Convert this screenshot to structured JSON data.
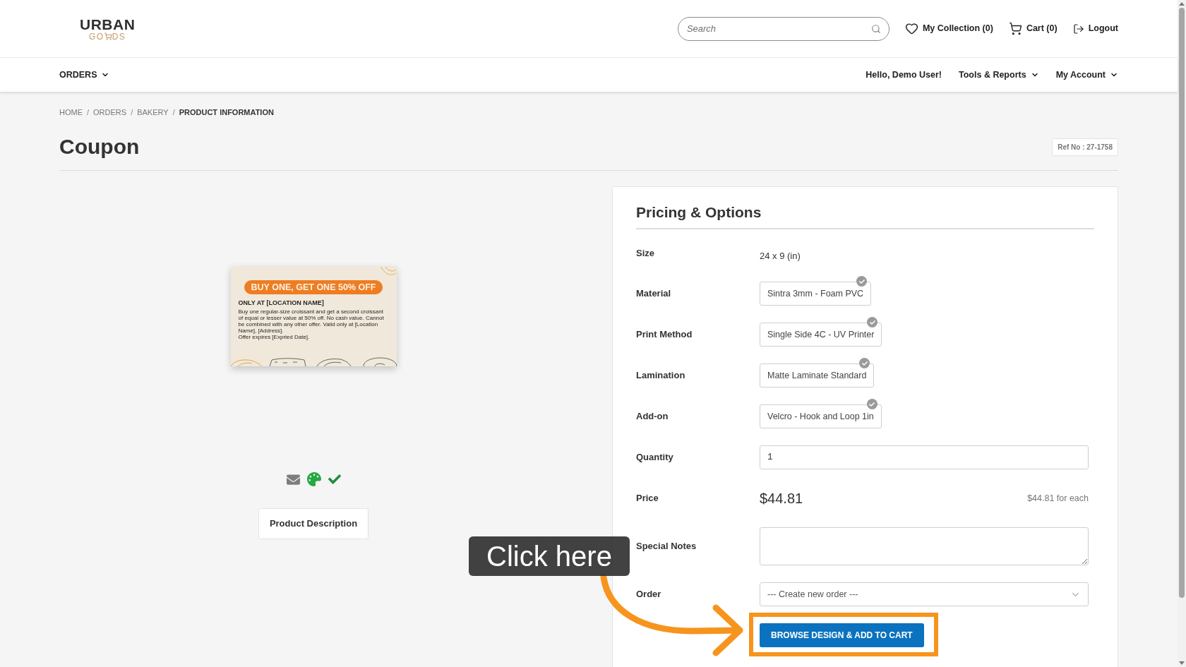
{
  "header": {
    "logo": {
      "top": "URBAN",
      "bottom_left": "GO",
      "bottom_right": "DS"
    },
    "search": {
      "placeholder": "Search"
    },
    "links": [
      {
        "kind": "collection",
        "label": "My Collection (0)"
      },
      {
        "kind": "cart",
        "label": "Cart (0)"
      },
      {
        "kind": "logout",
        "label": "Logout"
      }
    ]
  },
  "nav": {
    "left": [
      {
        "label": "ORDERS",
        "has_menu": true
      }
    ],
    "right": [
      {
        "label": "Hello, Demo User!",
        "has_menu": false
      },
      {
        "label": "Tools & Reports",
        "has_menu": true
      },
      {
        "label": "My Account",
        "has_menu": true
      }
    ]
  },
  "breadcrumb": {
    "separator": "/",
    "items": [
      {
        "label": "HOME",
        "current": false
      },
      {
        "label": "ORDERS",
        "current": false
      },
      {
        "label": "BAKERY",
        "current": false
      },
      {
        "label": "PRODUCT INFORMATION",
        "current": true
      }
    ]
  },
  "page": {
    "title": "Coupon",
    "ref_no": "Ref No : 27-1758"
  },
  "product": {
    "image": {
      "headline": "BUY ONE, GET ONE 50% OFF",
      "subheadline": "ONLY AT [LOCATION NAME]",
      "body": [
        "Buy one regular-size croissant and get a second croissant of equal or lesser value at 50% off. No cash value. Cannot be combined with any other offer. Valid only at [Location Name], [Address].",
        "Offer expires [Expried Date]."
      ]
    },
    "description_button": "Product Description"
  },
  "pricing": {
    "title": "Pricing & Options",
    "rows": [
      {
        "kind": "text",
        "label": "Size",
        "value": "24 x 9 (in)"
      },
      {
        "kind": "option",
        "label": "Material",
        "value": "Sintra 3mm - Foam PVC",
        "selected": true
      },
      {
        "kind": "option",
        "label": "Print Method",
        "value": "Single Side 4C - UV Printer",
        "selected": true
      },
      {
        "kind": "option",
        "label": "Lamination",
        "value": "Matte Laminate Standard",
        "selected": true
      },
      {
        "kind": "option",
        "label": "Add-on",
        "value": "Velcro - Hook and Loop 1in",
        "selected": true
      },
      {
        "kind": "input",
        "label": "Quantity",
        "value": "1"
      },
      {
        "kind": "price",
        "label": "Price",
        "value": "$44.81",
        "note": "$44.81 for each"
      },
      {
        "kind": "textarea",
        "label": "Special Notes"
      },
      {
        "kind": "select",
        "label": "Order",
        "value": "--- Create new order ---"
      }
    ],
    "submit": "BROWSE DESIGN & ADD TO CART"
  },
  "annotation": {
    "text": "Click here",
    "highlight_target": true
  }
}
